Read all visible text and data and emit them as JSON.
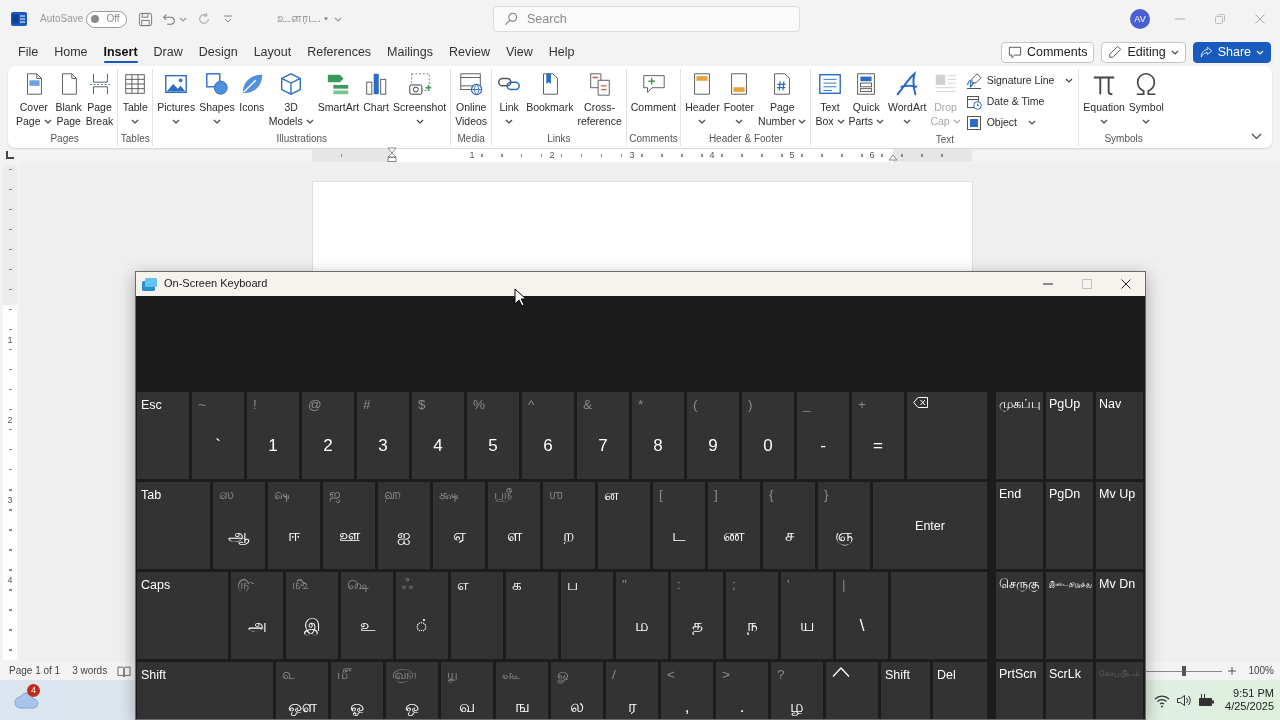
{
  "word": {
    "title_bar": {
      "autosave": {
        "label": "AutoSave",
        "toggle_text": "Off",
        "on": false
      },
      "document_title": "உ.ளரட. •",
      "search": {
        "placeholder": "Search"
      },
      "account_initials": "AV"
    },
    "menu_tabs": [
      {
        "label": "File",
        "selected": false
      },
      {
        "label": "Home",
        "selected": false
      },
      {
        "label": "Insert",
        "selected": true
      },
      {
        "label": "Draw",
        "selected": false
      },
      {
        "label": "Design",
        "selected": false
      },
      {
        "label": "Layout",
        "selected": false
      },
      {
        "label": "References",
        "selected": false
      },
      {
        "label": "Mailings",
        "selected": false
      },
      {
        "label": "Review",
        "selected": false
      },
      {
        "label": "View",
        "selected": false
      },
      {
        "label": "Help",
        "selected": false
      }
    ],
    "header_buttons": [
      {
        "kind": "comments",
        "label": "Comments"
      },
      {
        "kind": "editing",
        "label": "Editing"
      },
      {
        "kind": "share",
        "label": "Share"
      }
    ],
    "ribbon_groups": [
      {
        "label": "Pages",
        "buttons": [
          {
            "kind": "large",
            "lines": [
              "Cover",
              "Page"
            ],
            "dropdown": true,
            "disabled": false
          },
          {
            "kind": "large",
            "lines": [
              "Blank",
              "Page"
            ],
            "dropdown": false,
            "disabled": false
          },
          {
            "kind": "large",
            "lines": [
              "Page",
              "Break"
            ],
            "dropdown": false,
            "disabled": false
          }
        ]
      },
      {
        "label": "Tables",
        "buttons": [
          {
            "kind": "large",
            "lines": [
              "Table"
            ],
            "dropdown": true,
            "disabled": false
          }
        ]
      },
      {
        "label": "Illustrations",
        "buttons": [
          {
            "kind": "large",
            "lines": [
              "Pictures"
            ],
            "dropdown": true,
            "disabled": false
          },
          {
            "kind": "large",
            "lines": [
              "Shapes"
            ],
            "dropdown": true,
            "disabled": false
          },
          {
            "kind": "large",
            "lines": [
              "Icons"
            ],
            "dropdown": false,
            "disabled": false
          },
          {
            "kind": "large",
            "lines": [
              "3D",
              "Models"
            ],
            "dropdown": true,
            "disabled": false
          },
          {
            "kind": "large",
            "lines": [
              "SmartArt"
            ],
            "dropdown": false,
            "disabled": false
          },
          {
            "kind": "large",
            "lines": [
              "Chart"
            ],
            "dropdown": false,
            "disabled": false
          },
          {
            "kind": "large",
            "lines": [
              "Screenshot"
            ],
            "dropdown": true,
            "disabled": false
          }
        ]
      },
      {
        "label": "Media",
        "buttons": [
          {
            "kind": "large",
            "lines": [
              "Online",
              "Videos"
            ],
            "dropdown": false,
            "disabled": false
          }
        ]
      },
      {
        "label": "Links",
        "buttons": [
          {
            "kind": "large",
            "lines": [
              "Link"
            ],
            "dropdown": true,
            "disabled": false
          },
          {
            "kind": "large",
            "lines": [
              "Bookmark"
            ],
            "dropdown": false,
            "disabled": false
          },
          {
            "kind": "large",
            "lines": [
              "Cross-",
              "reference"
            ],
            "dropdown": false,
            "disabled": false
          }
        ]
      },
      {
        "label": "Comments",
        "buttons": [
          {
            "kind": "large",
            "lines": [
              "Comment"
            ],
            "dropdown": false,
            "disabled": false
          }
        ]
      },
      {
        "label": "Header & Footer",
        "buttons": [
          {
            "kind": "large",
            "lines": [
              "Header"
            ],
            "dropdown": true,
            "disabled": false
          },
          {
            "kind": "large",
            "lines": [
              "Footer"
            ],
            "dropdown": true,
            "disabled": false
          },
          {
            "kind": "large",
            "lines": [
              "Page",
              "Number"
            ],
            "dropdown": true,
            "disabled": false
          }
        ]
      },
      {
        "label": "Text",
        "buttons": [
          {
            "kind": "large",
            "lines": [
              "Text",
              "Box"
            ],
            "dropdown": true,
            "disabled": false
          },
          {
            "kind": "large",
            "lines": [
              "Quick",
              "Parts"
            ],
            "dropdown": true,
            "disabled": false
          },
          {
            "kind": "large",
            "lines": [
              "WordArt"
            ],
            "dropdown": true,
            "disabled": false
          },
          {
            "kind": "large",
            "lines": [
              "Drop",
              "Cap"
            ],
            "dropdown": true,
            "disabled": true
          },
          {
            "kind": "small",
            "label": "Signature Line",
            "dropdown": true,
            "disabled": false
          },
          {
            "kind": "small",
            "label": "Date & Time",
            "dropdown": false,
            "disabled": false
          },
          {
            "kind": "small",
            "label": "Object",
            "dropdown": true,
            "disabled": false
          }
        ]
      },
      {
        "label": "Symbols",
        "buttons": [
          {
            "kind": "large",
            "lines": [
              "Equation"
            ],
            "dropdown": true,
            "disabled": false
          },
          {
            "kind": "large",
            "lines": [
              "Symbol"
            ],
            "dropdown": true,
            "disabled": false
          }
        ]
      }
    ],
    "ruler_numbers": [
      "1",
      "2",
      "3",
      "4",
      "5",
      "6"
    ],
    "vertical_ruler_numbers": [
      "1",
      "2",
      "3",
      "4"
    ],
    "status_bar": {
      "page_count": "Page 1 of 1",
      "word_count": "3 words",
      "zoom_slider": {
        "level": 0.5
      },
      "zoom": "100%"
    }
  },
  "taskbar": {
    "notification_badge": "4",
    "time": "9:51 PM",
    "date": "4/25/2025"
  },
  "on_screen_keyboard": {
    "title": "On-Screen Keyboard",
    "rows": [
      {
        "keys": [
          {
            "kind": "label",
            "label": "Esc"
          },
          {
            "kind": "dual",
            "shift": "~",
            "main": "`"
          },
          {
            "kind": "dual",
            "shift": "!",
            "main": "1"
          },
          {
            "kind": "dual",
            "shift": "@",
            "main": "2"
          },
          {
            "kind": "dual",
            "shift": "#",
            "main": "3"
          },
          {
            "kind": "dual",
            "shift": "$",
            "main": "4"
          },
          {
            "kind": "dual",
            "shift": "%",
            "main": "5"
          },
          {
            "kind": "dual",
            "shift": "^",
            "main": "6"
          },
          {
            "kind": "dual",
            "shift": "&",
            "main": "7"
          },
          {
            "kind": "dual",
            "shift": "*",
            "main": "8"
          },
          {
            "kind": "dual",
            "shift": "(",
            "main": "9"
          },
          {
            "kind": "dual",
            "shift": ")",
            "main": "0"
          },
          {
            "kind": "dual",
            "shift": "_",
            "main": "-"
          },
          {
            "kind": "dual",
            "shift": "+",
            "main": "="
          },
          {
            "kind": "backspace"
          }
        ]
      },
      {
        "keys": [
          {
            "kind": "label",
            "label": "Tab"
          },
          {
            "kind": "dual",
            "shift": "ஸ",
            "main": "ஆ"
          },
          {
            "kind": "dual",
            "shift": "ஷ",
            "main": "ஈ"
          },
          {
            "kind": "dual",
            "shift": "ஜ",
            "main": "ஊ"
          },
          {
            "kind": "dual",
            "shift": "ஹ",
            "main": "ஐ"
          },
          {
            "kind": "dual",
            "shift": "க்ஷ",
            "main": "ஏ"
          },
          {
            "kind": "dual",
            "shift": "ஸ்ரீ",
            "main": "ள"
          },
          {
            "kind": "dual",
            "shift": "ஶ",
            "main": "ற"
          },
          {
            "kind": "single",
            "label": "ன"
          },
          {
            "kind": "dual",
            "shift": "[",
            "main": "ட"
          },
          {
            "kind": "dual",
            "shift": "]",
            "main": "ண"
          },
          {
            "kind": "dual",
            "shift": "{",
            "main": "ச"
          },
          {
            "kind": "dual",
            "shift": "}",
            "main": "ஞ"
          },
          {
            "kind": "label_center",
            "label": "Enter"
          }
        ]
      },
      {
        "keys": [
          {
            "kind": "label",
            "label": "Caps"
          },
          {
            "kind": "dual",
            "shift": "௹",
            "main": "அ"
          },
          {
            "kind": "dual",
            "shift": "௺",
            "main": "இ"
          },
          {
            "kind": "dual",
            "shift": "௸",
            "main": "உ"
          },
          {
            "kind": "dual",
            "shift": "ஃ",
            "main": "்"
          },
          {
            "kind": "single",
            "label": "எ"
          },
          {
            "kind": "single",
            "label": "க"
          },
          {
            "kind": "single",
            "label": "ப"
          },
          {
            "kind": "dual",
            "shift": "\"",
            "main": "ம"
          },
          {
            "kind": "dual",
            "shift": ":",
            "main": "த"
          },
          {
            "kind": "dual",
            "shift": ";",
            "main": "ந"
          },
          {
            "kind": "dual",
            "shift": "'",
            "main": "ய"
          },
          {
            "kind": "dual",
            "shift": "|",
            "main": "\\"
          },
          {
            "kind": "blank"
          }
        ]
      },
      {
        "keys": [
          {
            "kind": "label",
            "label": "Shift"
          },
          {
            "kind": "dual",
            "shift": "௳",
            "main": "ஔ"
          },
          {
            "kind": "dual",
            "shift": "௴",
            "main": "ஓ"
          },
          {
            "kind": "dual",
            "shift": "௵",
            "main": "ஒ"
          },
          {
            "kind": "dual",
            "shift": "௶",
            "main": "வ"
          },
          {
            "kind": "dual",
            "shift": "௷",
            "main": "ங"
          },
          {
            "kind": "dual",
            "shift": "ௐ",
            "main": "ல"
          },
          {
            "kind": "dual",
            "shift": "/",
            "main": "ர"
          },
          {
            "kind": "dual",
            "shift": "<",
            "main": ","
          },
          {
            "kind": "dual",
            "shift": ">",
            "main": "."
          },
          {
            "kind": "dual",
            "shift": "?",
            "main": "ழ"
          },
          {
            "kind": "arrow_up"
          },
          {
            "kind": "label",
            "label": "Shift"
          },
          {
            "kind": "label",
            "label": "Del"
          }
        ]
      }
    ],
    "side_rows": [
      [
        {
          "label": "முகப்பு",
          "disabled": false
        },
        {
          "label": "PgUp",
          "disabled": false
        },
        {
          "label": "Nav",
          "disabled": false
        }
      ],
      [
        {
          "label": "End",
          "disabled": false
        },
        {
          "label": "PgDn",
          "disabled": false
        },
        {
          "label": "Mv Up",
          "disabled": false
        }
      ],
      [
        {
          "label": "செருகு",
          "disabled": false
        },
        {
          "label": "இடைநிறுத்து",
          "disabled": false
        },
        {
          "label": "Mv Dn",
          "disabled": false
        }
      ],
      [
        {
          "label": "PrtScn",
          "disabled": false
        },
        {
          "label": "ScrLk",
          "disabled": false
        },
        {
          "label": "கோப்பிடம்",
          "disabled": true
        }
      ]
    ]
  }
}
